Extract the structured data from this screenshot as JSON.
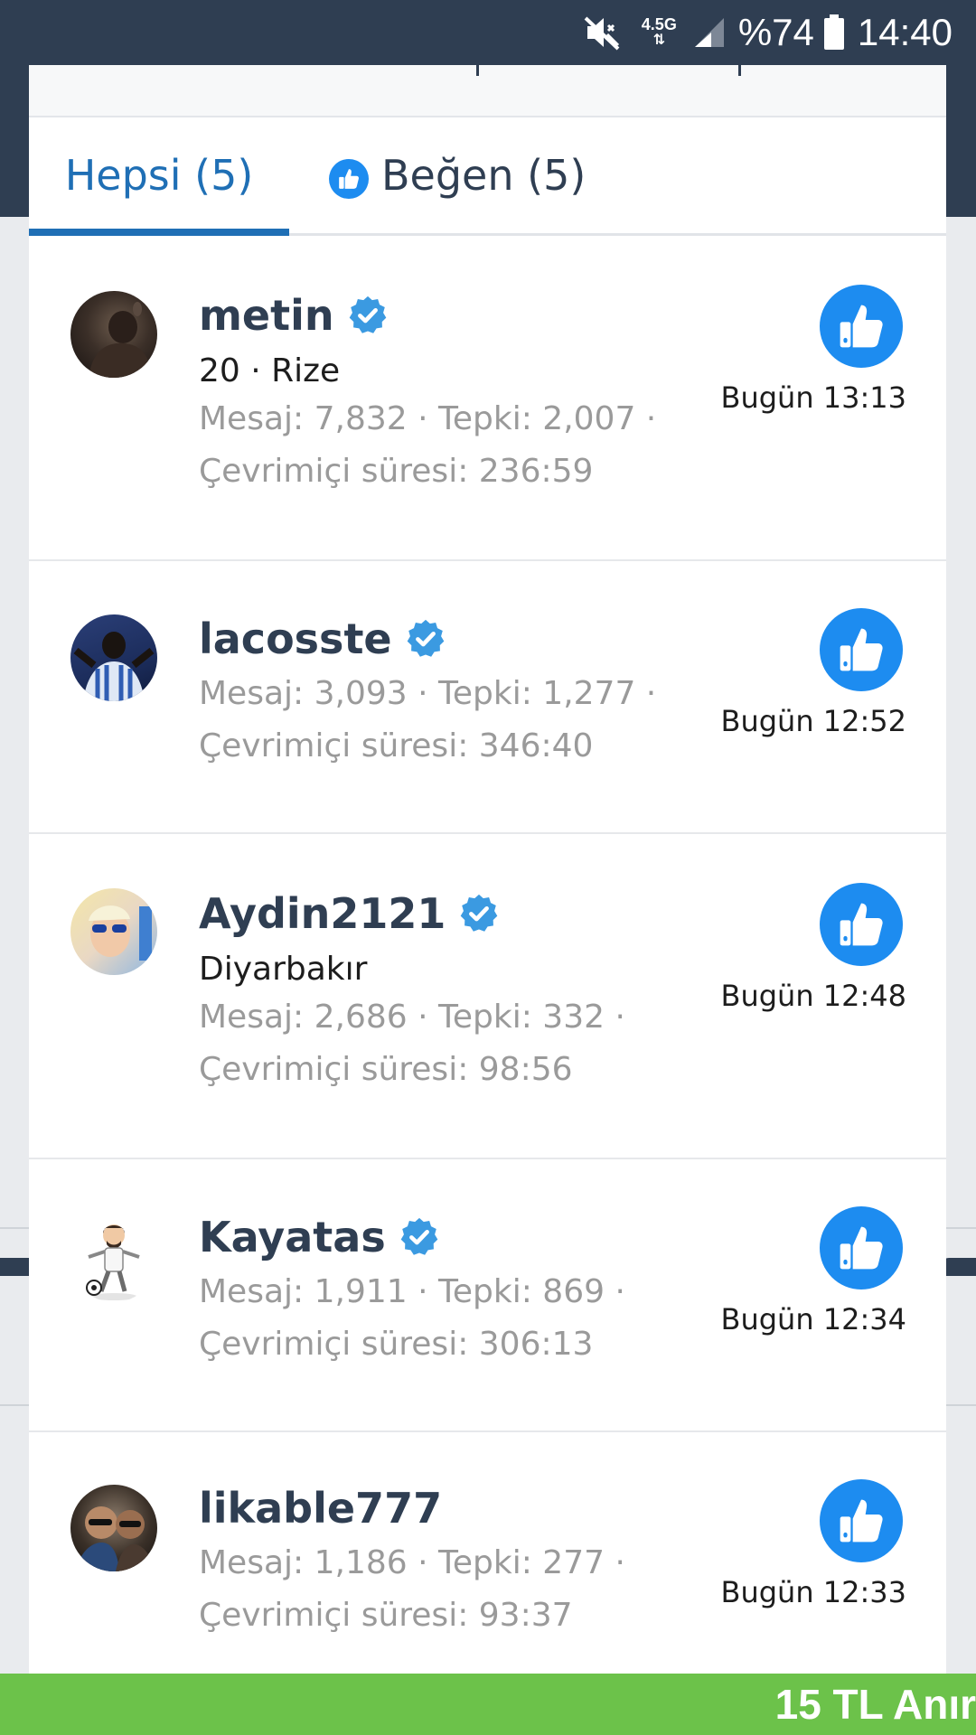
{
  "status_bar": {
    "network": "4.5G",
    "battery_percent": "%74",
    "time": "14:40",
    "icons": [
      "mute-icon",
      "signal-icon",
      "battery-icon"
    ]
  },
  "tabs": [
    {
      "label": "Hepsi (5)",
      "active": true
    },
    {
      "label": "Beğen (5)",
      "active": false,
      "icon": "like-icon"
    }
  ],
  "reactions": [
    {
      "username": "metin",
      "verified": true,
      "subtitle": "20 · Rize",
      "stats": "Mesaj: 7,832 · Tepki: 2,007 ·",
      "online": "Çevrimiçi süresi: 236:59",
      "reaction": "like-icon",
      "time": "Bugün 13:13"
    },
    {
      "username": "lacosste",
      "verified": true,
      "subtitle": "",
      "stats": "Mesaj: 3,093 · Tepki: 1,277 ·",
      "online": "Çevrimiçi süresi: 346:40",
      "reaction": "like-icon",
      "time": "Bugün 12:52"
    },
    {
      "username": "Aydin2121",
      "verified": true,
      "subtitle": "Diyarbakır",
      "stats": "Mesaj: 2,686 · Tepki: 332 ·",
      "online": "Çevrimiçi süresi: 98:56",
      "reaction": "like-icon",
      "time": "Bugün 12:48"
    },
    {
      "username": "Kayatas",
      "verified": true,
      "subtitle": "",
      "stats": "Mesaj: 1,911 · Tepki: 869 ·",
      "online": "Çevrimiçi süresi: 306:13",
      "reaction": "like-icon",
      "time": "Bugün 12:34"
    },
    {
      "username": "likable777",
      "verified": false,
      "subtitle": "",
      "stats": "Mesaj: 1,186 · Tepki: 277 ·",
      "online": "Çevrimiçi süresi: 93:37",
      "reaction": "like-icon",
      "time": "Bugün 12:33"
    }
  ],
  "banner": {
    "text": "15 TL Anır"
  },
  "colors": {
    "header": "#2f3e52",
    "accent": "#1f6fb5",
    "like": "#1d8cf0",
    "verified": "#3b9ae1",
    "banner": "#6cc24a"
  }
}
